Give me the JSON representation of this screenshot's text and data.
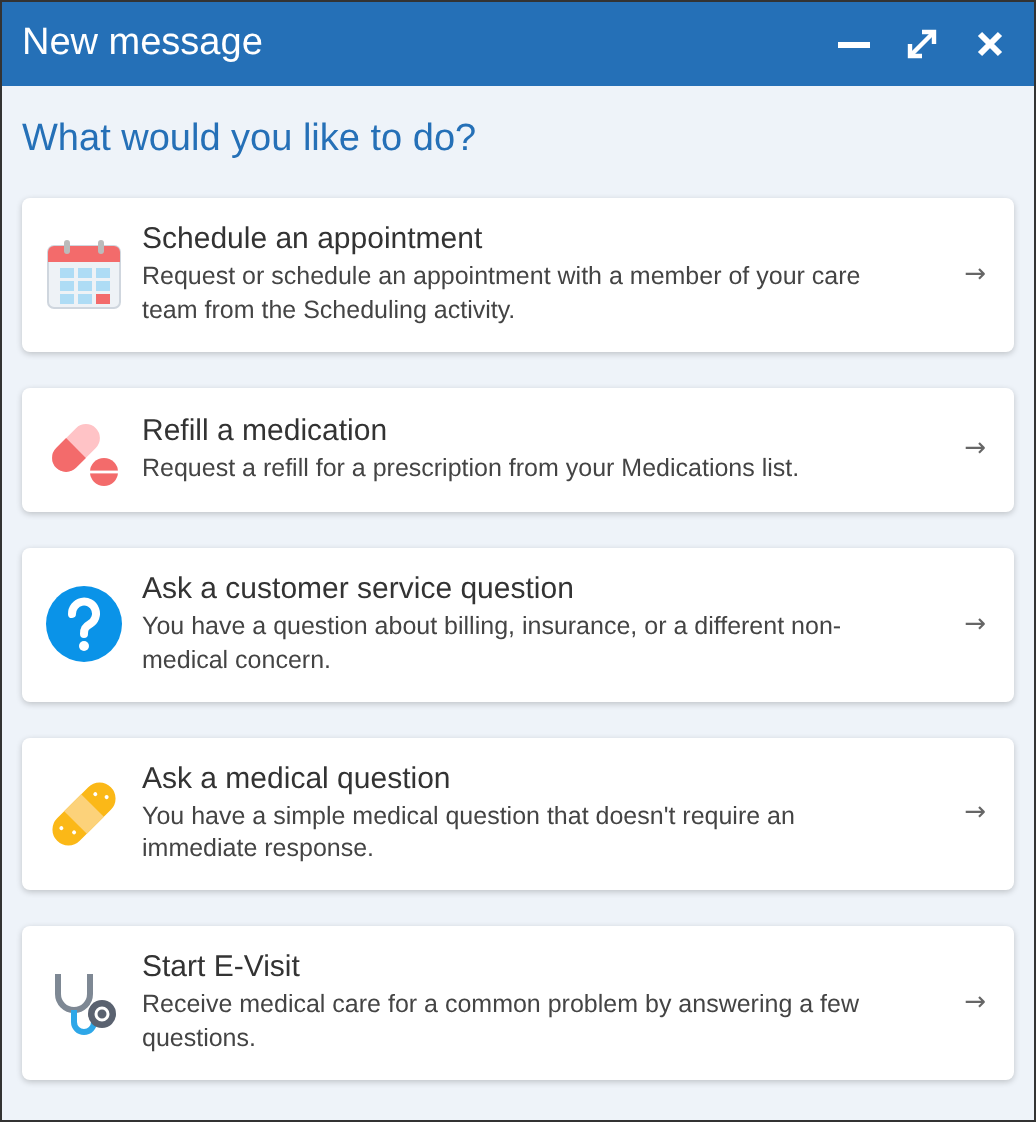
{
  "window": {
    "title": "New message"
  },
  "prompt": "What would you like to do?",
  "options": [
    {
      "kind": "calendar",
      "title": "Schedule an appointment",
      "description": "Request or schedule an appointment with a member of your care team from the Scheduling activity.",
      "arrow": "→"
    },
    {
      "kind": "pill",
      "title": "Refill a medication",
      "description": "Request a refill for a prescription from your Medications list.",
      "arrow": "→"
    },
    {
      "kind": "question",
      "title": "Ask a customer service question",
      "description": "You have a question about billing, insurance, or a different non-medical concern.",
      "arrow": "→"
    },
    {
      "kind": "bandage",
      "title": "Ask a medical question",
      "description": "You have a simple medical question that doesn't require an immediate response.",
      "arrow": "→"
    },
    {
      "kind": "stethoscope",
      "title": "Start E-Visit",
      "description": "Receive medical care for a common problem by answering a few questions.",
      "arrow": "→"
    }
  ]
}
